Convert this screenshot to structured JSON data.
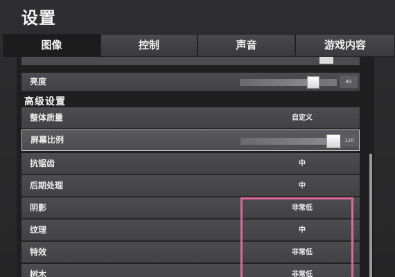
{
  "window": {
    "title": "设置"
  },
  "tabs": [
    {
      "label": "图像",
      "active": true
    },
    {
      "label": "控制",
      "active": false
    },
    {
      "label": "声音",
      "active": false
    },
    {
      "label": "游戏内容",
      "active": false
    }
  ],
  "brightness": {
    "label": "亮度",
    "value": "80"
  },
  "advanced": {
    "header": "高级设置"
  },
  "rows": {
    "overall_quality": {
      "label": "整体质量",
      "value": "自定义"
    },
    "screen_scale": {
      "label": "屏幕比例",
      "value": "120"
    },
    "anti_aliasing": {
      "label": "抗锯齿",
      "value": "中"
    },
    "post_processing": {
      "label": "后期处理",
      "value": "中"
    },
    "shadows": {
      "label": "阴影",
      "value": "非常低"
    },
    "textures": {
      "label": "纹理",
      "value": "中"
    },
    "effects": {
      "label": "特效",
      "value": "非常低"
    },
    "foliage": {
      "label": "树木",
      "value": "非常低"
    }
  },
  "colors": {
    "annotation": "#e0679e",
    "active_tab": "#1c1c1d"
  }
}
